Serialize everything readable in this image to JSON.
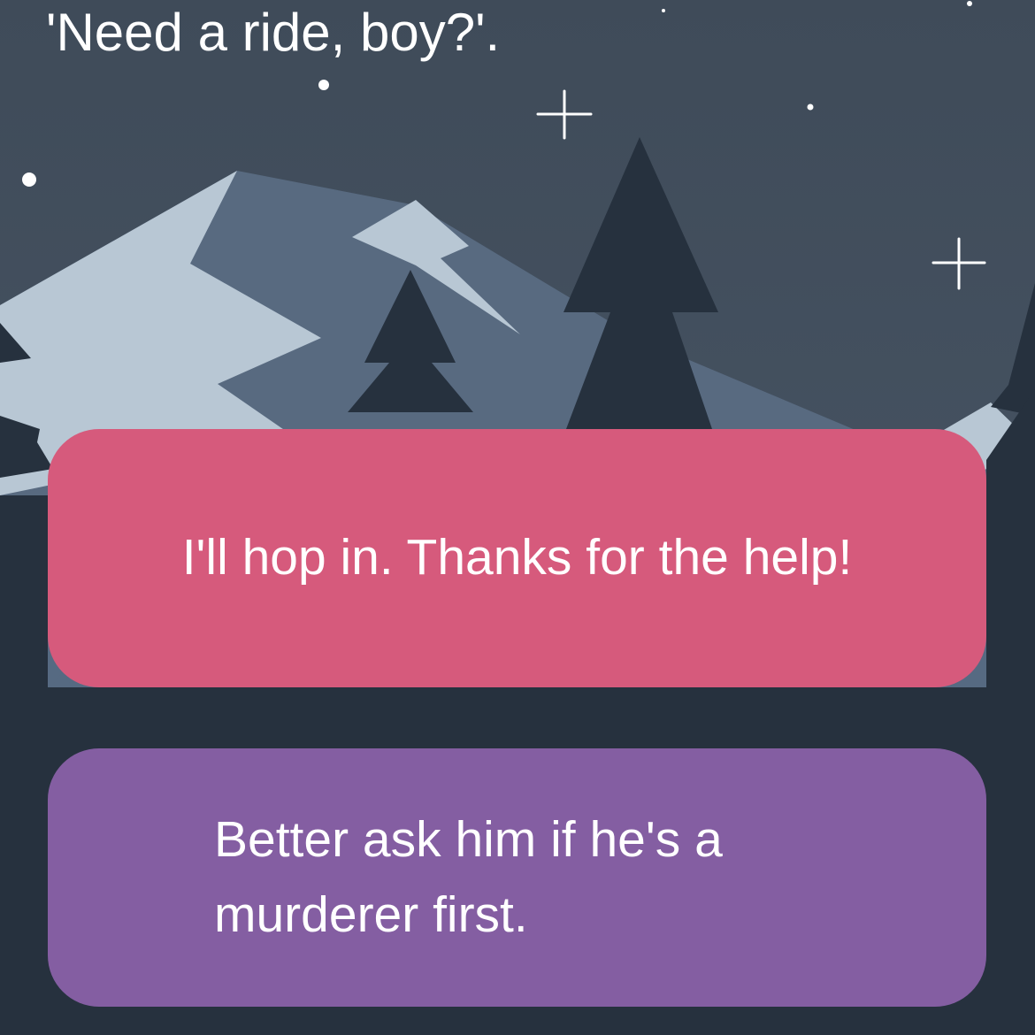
{
  "narration": "'Need a ride, boy?'.",
  "choices": [
    {
      "label": "I'll hop in. Thanks for the help!",
      "color": "#d65a7c"
    },
    {
      "label": "Better ask him if he's a murderer first.",
      "color": "#845ea2"
    }
  ],
  "palette": {
    "sky_top": "#3f4b59",
    "sky_bottom": "#4a5868",
    "mountain_shadow": "#586a80",
    "mountain_snow": "#b8c7d4",
    "far_trees": "#566a82",
    "mid_trees": "#3d4c5c",
    "near_trees": "#26313e",
    "stars": "#ffffff"
  }
}
